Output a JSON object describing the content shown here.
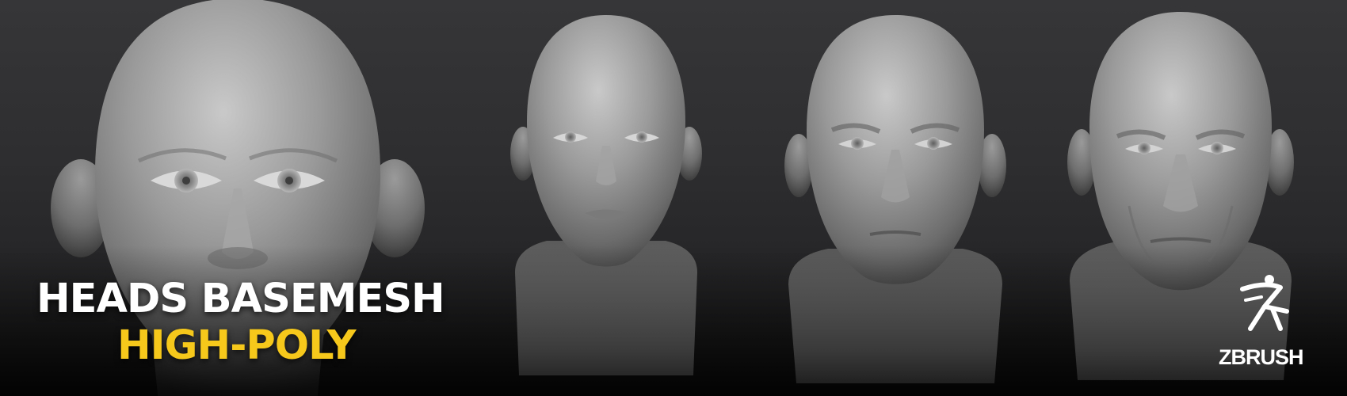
{
  "title": {
    "line1": "HEADS BASEMESH",
    "line2": "HIGH-POLY",
    "line1_color": "#ffffff",
    "line2_color": "#f6c81c"
  },
  "logo": {
    "wordmark": "ZBRUSH",
    "icon": "zbrush-running-figure-icon"
  },
  "background_color": "#2b2b2d",
  "clay_color": "#8c8c8c",
  "heads": [
    {
      "name": "neutral-head",
      "icon": "head-render"
    },
    {
      "name": "female-head",
      "icon": "head-render"
    },
    {
      "name": "male-head",
      "icon": "head-render"
    },
    {
      "name": "old-male-head",
      "icon": "head-render"
    }
  ]
}
